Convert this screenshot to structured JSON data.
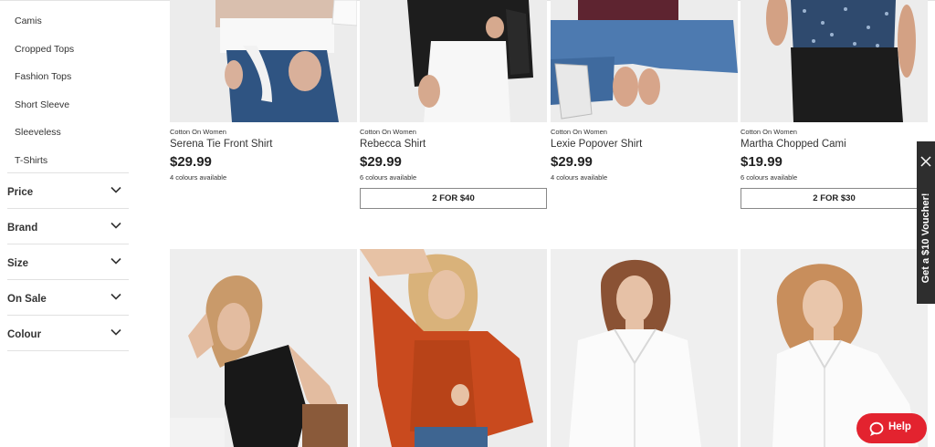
{
  "sidebar": {
    "subcategories": [
      "Camis",
      "Cropped Tops",
      "Fashion Tops",
      "Short Sleeve",
      "Sleeveless",
      "T-Shirts"
    ],
    "filters": [
      "Price",
      "Brand",
      "Size",
      "On Sale",
      "Colour"
    ]
  },
  "products": [
    {
      "brand": "Cotton On Women",
      "name": "Serena Tie Front Shirt",
      "price": "$29.99",
      "colours": "4 colours available",
      "promo": ""
    },
    {
      "brand": "Cotton On Women",
      "name": "Rebecca Shirt",
      "price": "$29.99",
      "colours": "6 colours available",
      "promo": "2 FOR $40"
    },
    {
      "brand": "Cotton On Women",
      "name": "Lexie Popover Shirt",
      "price": "$29.99",
      "colours": "4 colours available",
      "promo": ""
    },
    {
      "brand": "Cotton On Women",
      "name": "Martha Chopped Cami",
      "price": "$19.99",
      "colours": "6 colours available",
      "promo": "2 FOR $30"
    }
  ],
  "voucher": {
    "label": "Get a $10 Voucher!",
    "icon": "close-icon"
  },
  "help": {
    "label": "Help",
    "icon": "chat-bubble-icon"
  },
  "colors": {
    "help_button": "#e3232f",
    "voucher_tab": "#2e2e2e",
    "promo_border": "#888888"
  }
}
